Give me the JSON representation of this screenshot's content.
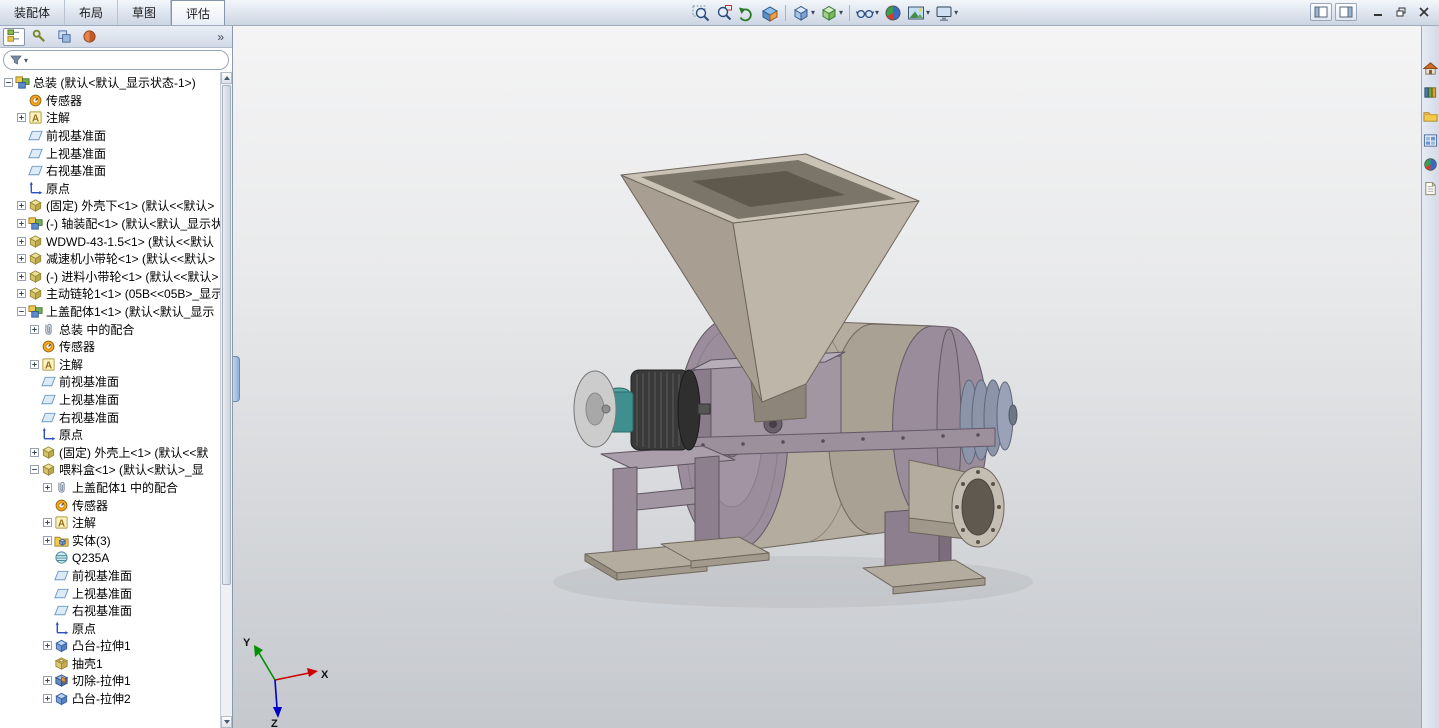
{
  "command_tabs": {
    "items": [
      "装配体",
      "布局",
      "草图",
      "评估"
    ],
    "active_index": 3
  },
  "heads_up": {
    "buttons": [
      {
        "name": "zoom-to-fit",
        "icon": "zoom-fit",
        "dropdown": false
      },
      {
        "name": "zoom-to-area",
        "icon": "zoom-area",
        "dropdown": false
      },
      {
        "name": "previous-view",
        "icon": "previous-view",
        "dropdown": false
      },
      {
        "name": "section-view",
        "icon": "section-view",
        "dropdown": false
      },
      {
        "separator": true
      },
      {
        "name": "view-orientation",
        "icon": "view-cube",
        "dropdown": true
      },
      {
        "name": "display-style",
        "icon": "display-style",
        "dropdown": true
      },
      {
        "separator": true
      },
      {
        "name": "hide-show-items",
        "icon": "glasses",
        "dropdown": true
      },
      {
        "name": "edit-appearance",
        "icon": "appearance-sphere",
        "dropdown": false
      },
      {
        "name": "apply-scene",
        "icon": "scene",
        "dropdown": true
      },
      {
        "name": "view-settings",
        "icon": "monitor",
        "dropdown": true
      }
    ]
  },
  "window_controls": {
    "pane_toggles": [
      {
        "name": "toggle-featuremanager-pane",
        "icon": "pane-left"
      },
      {
        "name": "toggle-task-pane",
        "icon": "pane-right"
      }
    ],
    "buttons": [
      {
        "name": "minimize-window",
        "glyph": "minimize"
      },
      {
        "name": "restore-window",
        "glyph": "restore"
      },
      {
        "name": "close-window",
        "glyph": "close"
      }
    ]
  },
  "panel_tabs": {
    "tabs": [
      {
        "name": "featuremanager-design-tree",
        "icon": "fm-tree"
      },
      {
        "name": "propertymanager",
        "icon": "fm-property"
      },
      {
        "name": "configurationmanager",
        "icon": "fm-config"
      },
      {
        "name": "displaymanager",
        "icon": "fm-display"
      }
    ],
    "overflow_label": "»"
  },
  "filter_bar": {
    "placeholder": ""
  },
  "feature_tree": {
    "items": [
      {
        "label": "总装 (默认<默认_显示状态-1>)",
        "level": 0,
        "expander": "minus",
        "icon": "assembly"
      },
      {
        "label": "传感器",
        "level": 1,
        "expander": "none",
        "icon": "sensor"
      },
      {
        "label": "注解",
        "level": 1,
        "expander": "plus",
        "icon": "annotation"
      },
      {
        "label": "前视基准面",
        "level": 1,
        "expander": "none",
        "icon": "plane"
      },
      {
        "label": "上视基准面",
        "level": 1,
        "expander": "none",
        "icon": "plane"
      },
      {
        "label": "右视基准面",
        "level": 1,
        "expander": "none",
        "icon": "plane"
      },
      {
        "label": "原点",
        "level": 1,
        "expander": "none",
        "icon": "origin"
      },
      {
        "label": "(固定) 外壳下<1> (默认<<默认>",
        "level": 1,
        "expander": "plus",
        "icon": "part"
      },
      {
        "label": "(-) 轴装配<1> (默认<默认_显示状",
        "level": 1,
        "expander": "plus",
        "icon": "assembly"
      },
      {
        "label": "WDWD-43-1.5<1> (默认<<默认",
        "level": 1,
        "expander": "plus",
        "icon": "part"
      },
      {
        "label": "减速机小带轮<1> (默认<<默认>",
        "level": 1,
        "expander": "plus",
        "icon": "part"
      },
      {
        "label": "(-) 进料小带轮<1> (默认<<默认>",
        "level": 1,
        "expander": "plus",
        "icon": "part"
      },
      {
        "label": "主动链轮1<1> (05B<<05B>_显示",
        "level": 1,
        "expander": "plus",
        "icon": "part"
      },
      {
        "label": "上盖配体1<1> (默认<默认_显示",
        "level": 1,
        "expander": "minus",
        "icon": "assembly"
      },
      {
        "label": "总装 中的配合",
        "level": 2,
        "expander": "plus",
        "icon": "mates"
      },
      {
        "label": "传感器",
        "level": 2,
        "expander": "none",
        "icon": "sensor"
      },
      {
        "label": "注解",
        "level": 2,
        "expander": "plus",
        "icon": "annotation"
      },
      {
        "label": "前视基准面",
        "level": 2,
        "expander": "none",
        "icon": "plane"
      },
      {
        "label": "上视基准面",
        "level": 2,
        "expander": "none",
        "icon": "plane"
      },
      {
        "label": "右视基准面",
        "level": 2,
        "expander": "none",
        "icon": "plane"
      },
      {
        "label": "原点",
        "level": 2,
        "expander": "none",
        "icon": "origin"
      },
      {
        "label": "(固定) 外壳上<1> (默认<<默",
        "level": 2,
        "expander": "plus",
        "icon": "part"
      },
      {
        "label": "喂料盒<1> (默认<默认>_显",
        "level": 2,
        "expander": "minus",
        "icon": "part"
      },
      {
        "label": "上盖配体1 中的配合",
        "level": 3,
        "expander": "plus",
        "icon": "mates"
      },
      {
        "label": "传感器",
        "level": 3,
        "expander": "none",
        "icon": "sensor"
      },
      {
        "label": "注解",
        "level": 3,
        "expander": "plus",
        "icon": "annotation"
      },
      {
        "label": "实体(3)",
        "level": 3,
        "expander": "plus",
        "icon": "solids-folder"
      },
      {
        "label": "Q235A",
        "level": 3,
        "expander": "none",
        "icon": "material"
      },
      {
        "label": "前视基准面",
        "level": 3,
        "expander": "none",
        "icon": "plane"
      },
      {
        "label": "上视基准面",
        "level": 3,
        "expander": "none",
        "icon": "plane"
      },
      {
        "label": "右视基准面",
        "level": 3,
        "expander": "none",
        "icon": "plane"
      },
      {
        "label": "原点",
        "level": 3,
        "expander": "none",
        "icon": "origin"
      },
      {
        "label": "凸台-拉伸1",
        "level": 3,
        "expander": "plus",
        "icon": "boss-extrude"
      },
      {
        "label": "抽壳1",
        "level": 3,
        "expander": "none",
        "icon": "shell"
      },
      {
        "label": "切除-拉伸1",
        "level": 3,
        "expander": "plus",
        "icon": "cut-extrude"
      },
      {
        "label": "凸台-拉伸2",
        "level": 3,
        "expander": "plus",
        "icon": "boss-extrude"
      }
    ]
  },
  "task_pane": {
    "icons": [
      {
        "name": "solidworks-resources",
        "icon": "home"
      },
      {
        "name": "design-library",
        "icon": "library"
      },
      {
        "name": "file-explorer",
        "icon": "folder"
      },
      {
        "name": "view-palette",
        "icon": "palette"
      },
      {
        "name": "appearances-scenes",
        "icon": "sphere"
      },
      {
        "name": "custom-properties",
        "icon": "page"
      }
    ]
  },
  "triad": {
    "x": "X",
    "y": "Y",
    "z": "Z"
  },
  "colors": {
    "hopper_tan": "#beb6a9",
    "body_tan": "#b4ac9f",
    "housing_purple": "#a396a3",
    "end_cap_purple": "#9b8d9b",
    "motor_dark": "#3a3a3a",
    "gearbox_teal": "#3f8f8f",
    "pulley_blue": "#8b94a8",
    "viewport_top": "#f4f4f5",
    "viewport_bottom": "#c5c8cd"
  }
}
